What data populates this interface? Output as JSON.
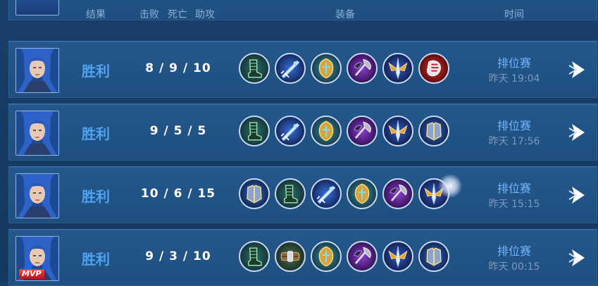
{
  "header": {
    "result": "结果",
    "kills": "击败",
    "deaths": "死亡",
    "assists": "助攻",
    "equipment": "装备",
    "time": "时间"
  },
  "matches": [
    {
      "result": "胜利",
      "kda": "8 / 9 / 10",
      "mode": "排位赛",
      "time": "昨天 19:04",
      "mvp": false,
      "items": [
        "boots-icon",
        "blue-blade-icon",
        "golden-shield-icon",
        "purple-axe-icon",
        "winged-sword-icon",
        "red-gauntlet-icon"
      ]
    },
    {
      "result": "胜利",
      "kda": "9 / 5 / 5",
      "mode": "排位赛",
      "time": "昨天 17:56",
      "mvp": false,
      "items": [
        "boots-icon",
        "blue-blade-icon",
        "golden-shield-icon",
        "purple-axe-icon",
        "winged-sword-icon",
        "armor-icon"
      ]
    },
    {
      "result": "胜利",
      "kda": "10 / 6 / 15",
      "mode": "排位赛",
      "time": "昨天 15:15",
      "mvp": false,
      "items": [
        "armor-icon",
        "boots-icon",
        "blue-blade-icon",
        "golden-shield-icon",
        "purple-axe-icon",
        "winged-sword-icon"
      ]
    },
    {
      "result": "胜利",
      "kda": "9 / 3 / 10",
      "mode": "排位赛",
      "time": "昨天 00:15",
      "mvp": true,
      "mvp_label": "MVP",
      "items": [
        "boots-icon",
        "belt-icon",
        "golden-shield-icon",
        "purple-axe-icon",
        "winged-sword-icon",
        "armor-icon"
      ]
    }
  ]
}
